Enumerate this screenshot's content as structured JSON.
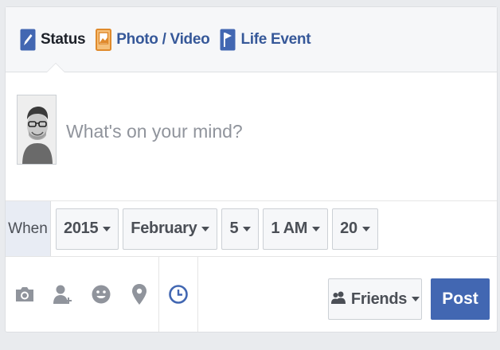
{
  "tabs": [
    {
      "label": "Status",
      "icon": "pencil-icon"
    },
    {
      "label": "Photo / Video",
      "icon": "photo-icon"
    },
    {
      "label": "Life Event",
      "icon": "flag-icon"
    }
  ],
  "composer": {
    "placeholder": "What's on your mind?"
  },
  "when": {
    "label": "When",
    "year": "2015",
    "month": "February",
    "day": "5",
    "hour": "1 AM",
    "minute": "20"
  },
  "footer": {
    "icons": [
      "camera-icon",
      "tag-friends-icon",
      "emoji-icon",
      "location-pin-icon",
      "clock-icon"
    ],
    "audience_label": "Friends",
    "post_label": "Post"
  },
  "colors": {
    "brand_blue": "#4267b2",
    "link_blue": "#365899",
    "clock_blue": "#4267b2",
    "icon_gray": "#90949c"
  }
}
